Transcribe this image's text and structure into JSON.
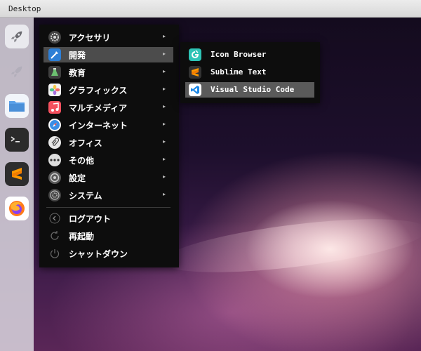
{
  "window": {
    "title": "Desktop"
  },
  "dock": {
    "items": [
      {
        "icon": "rocket-launcher-icon"
      },
      {
        "icon": "rocket-launcher-faded-icon"
      },
      {
        "icon": "files-folder-icon"
      },
      {
        "icon": "terminal-icon"
      },
      {
        "icon": "sublime-text-icon"
      },
      {
        "icon": "firefox-icon"
      }
    ]
  },
  "menu": {
    "categories": [
      {
        "label": "アクセサリ",
        "icon": "accessories-icon",
        "arrow": "▸"
      },
      {
        "label": "開発",
        "icon": "development-icon",
        "arrow": "▸",
        "active": true
      },
      {
        "label": "教育",
        "icon": "education-icon",
        "arrow": "▸"
      },
      {
        "label": "グラフィックス",
        "icon": "graphics-icon",
        "arrow": "▸"
      },
      {
        "label": "マルチメディア",
        "icon": "multimedia-icon",
        "arrow": "▸"
      },
      {
        "label": "インターネット",
        "icon": "internet-icon",
        "arrow": "▸"
      },
      {
        "label": "オフィス",
        "icon": "office-icon",
        "arrow": "▸"
      },
      {
        "label": "その他",
        "icon": "other-icon",
        "arrow": "▸"
      },
      {
        "label": "設定",
        "icon": "settings-icon",
        "arrow": "▸"
      },
      {
        "label": "システム",
        "icon": "system-icon",
        "arrow": "▸"
      }
    ],
    "session": [
      {
        "label": "ログアウト",
        "icon": "logout-icon"
      },
      {
        "label": "再起動",
        "icon": "restart-icon"
      },
      {
        "label": "シャットダウン",
        "icon": "shutdown-icon"
      }
    ]
  },
  "submenu": {
    "items": [
      {
        "label": "Icon Browser",
        "icon": "icon-browser-icon"
      },
      {
        "label": "Sublime Text",
        "icon": "sublime-text-icon"
      },
      {
        "label": "Visual Studio Code",
        "icon": "vscode-icon",
        "active": true
      }
    ]
  },
  "colors": {
    "menu_background": "#0d0d0d",
    "menu_active": "#4c4c4c",
    "submenu_active": "#5a5a5a",
    "dock_background": "#d7d2dc"
  }
}
